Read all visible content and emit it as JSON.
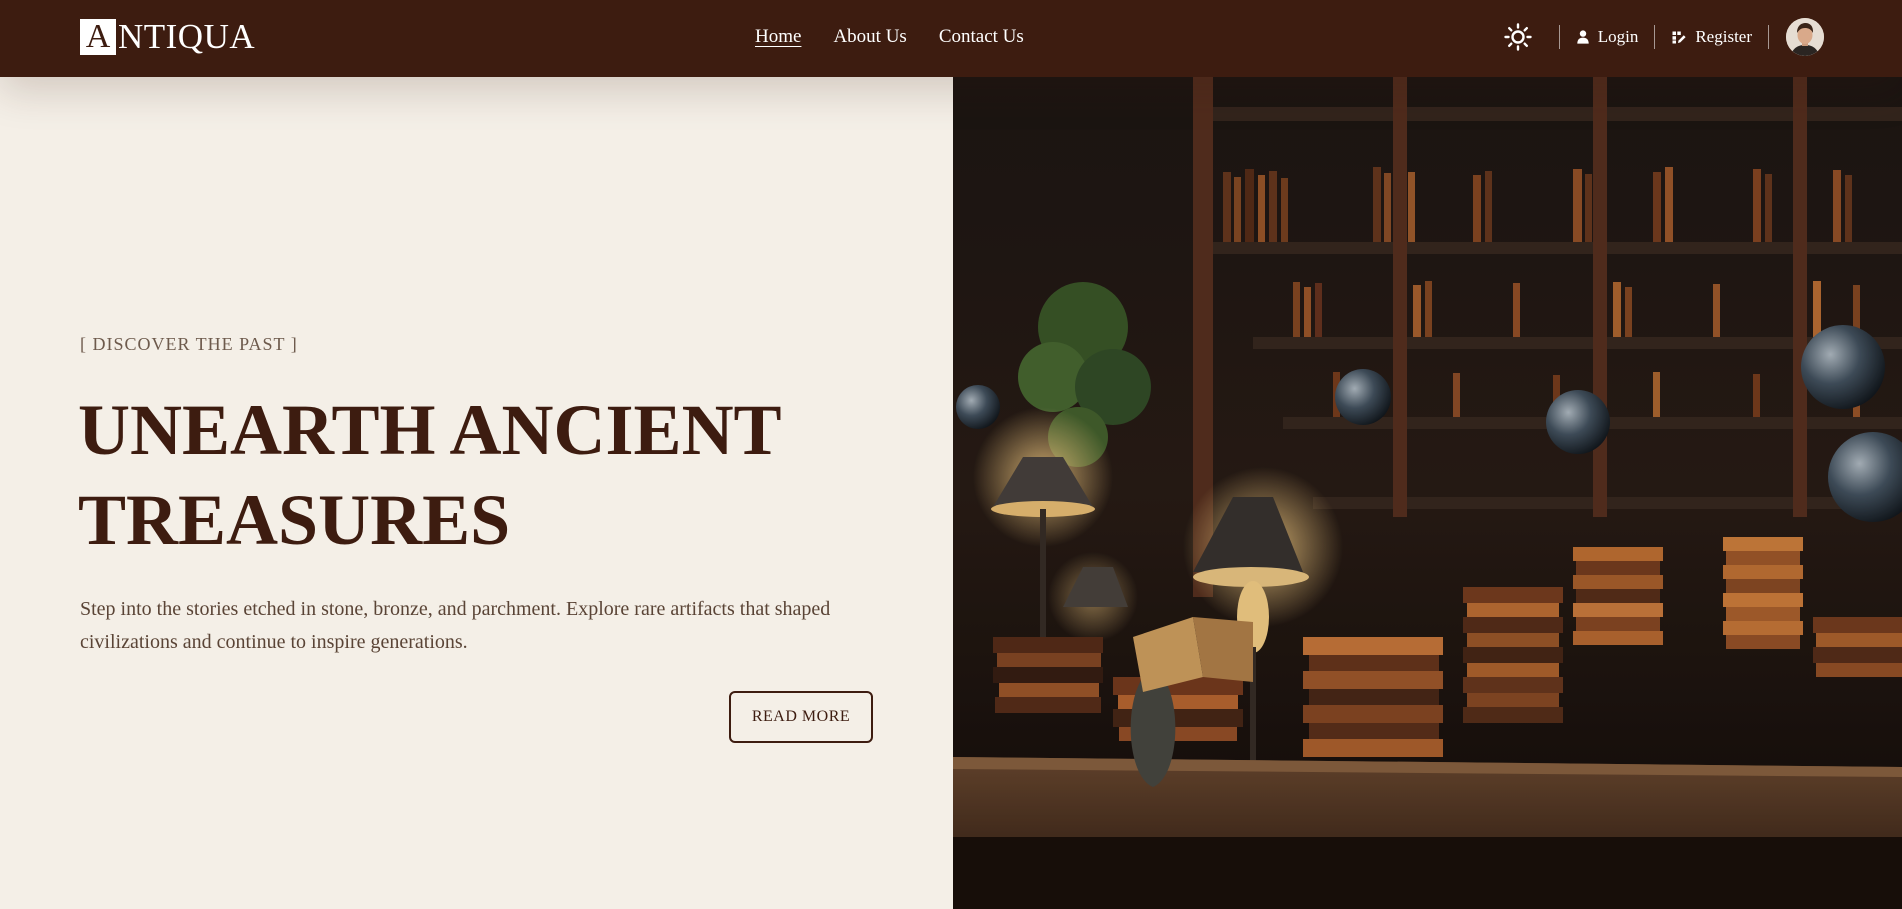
{
  "header": {
    "logo": {
      "initial": "A",
      "rest": "NTIQUA"
    },
    "nav": [
      {
        "label": "Home",
        "active": true
      },
      {
        "label": "About Us",
        "active": false
      },
      {
        "label": "Contact Us",
        "active": false
      }
    ],
    "theme_toggle_icon": "sun-icon",
    "login_label": "Login",
    "register_label": "Register",
    "avatar_icon": "avatar"
  },
  "hero": {
    "eyebrow": "[ DISCOVER THE PAST ]",
    "headline_line1": "UNEARTH ANCIENT",
    "headline_line2": "TREASURES",
    "description": "Step into the stories etched in stone, bronze, and parchment. Explore rare artifacts that shaped civilizations and continue to inspire generations.",
    "cta_label": "READ MORE"
  },
  "colors": {
    "brand": "#3d1c10",
    "background": "#f4efe7",
    "text_muted": "#6d5a4c"
  }
}
